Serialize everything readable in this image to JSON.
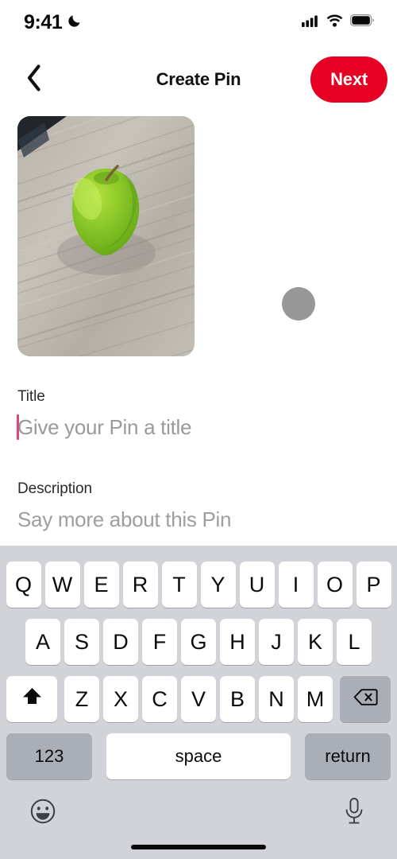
{
  "status_bar": {
    "time": "9:41",
    "dnd_icon": "moon-icon",
    "signal_icon": "cellular-signal-icon",
    "wifi_icon": "wifi-icon",
    "battery_icon": "battery-icon"
  },
  "nav": {
    "back_icon": "chevron-left-icon",
    "title": "Create Pin",
    "next_label": "Next",
    "next_color": "#e60023"
  },
  "media": {
    "thumbnail_alt": "green apple on grey wooden table",
    "placeholder_dot_color": "#979797"
  },
  "form": {
    "title": {
      "label": "Title",
      "value": "",
      "placeholder": "Give your Pin a title",
      "focused": true,
      "caret_color": "#e0457b"
    },
    "description": {
      "label": "Description",
      "value": "",
      "placeholder": "Say more about this Pin",
      "focused": false
    }
  },
  "keyboard": {
    "background": "#d1d3d9",
    "row1": [
      "Q",
      "W",
      "E",
      "R",
      "T",
      "Y",
      "U",
      "I",
      "O",
      "P"
    ],
    "row2": [
      "A",
      "S",
      "D",
      "F",
      "G",
      "H",
      "J",
      "K",
      "L"
    ],
    "row3": [
      "Z",
      "X",
      "C",
      "V",
      "B",
      "N",
      "M"
    ],
    "shift_icon": "shift-arrow-icon",
    "backspace_icon": "backspace-delete-icon",
    "numbers_label": "123",
    "space_label": "space",
    "return_label": "return",
    "emoji_icon": "emoji-smiley-icon",
    "dictation_icon": "microphone-icon"
  }
}
